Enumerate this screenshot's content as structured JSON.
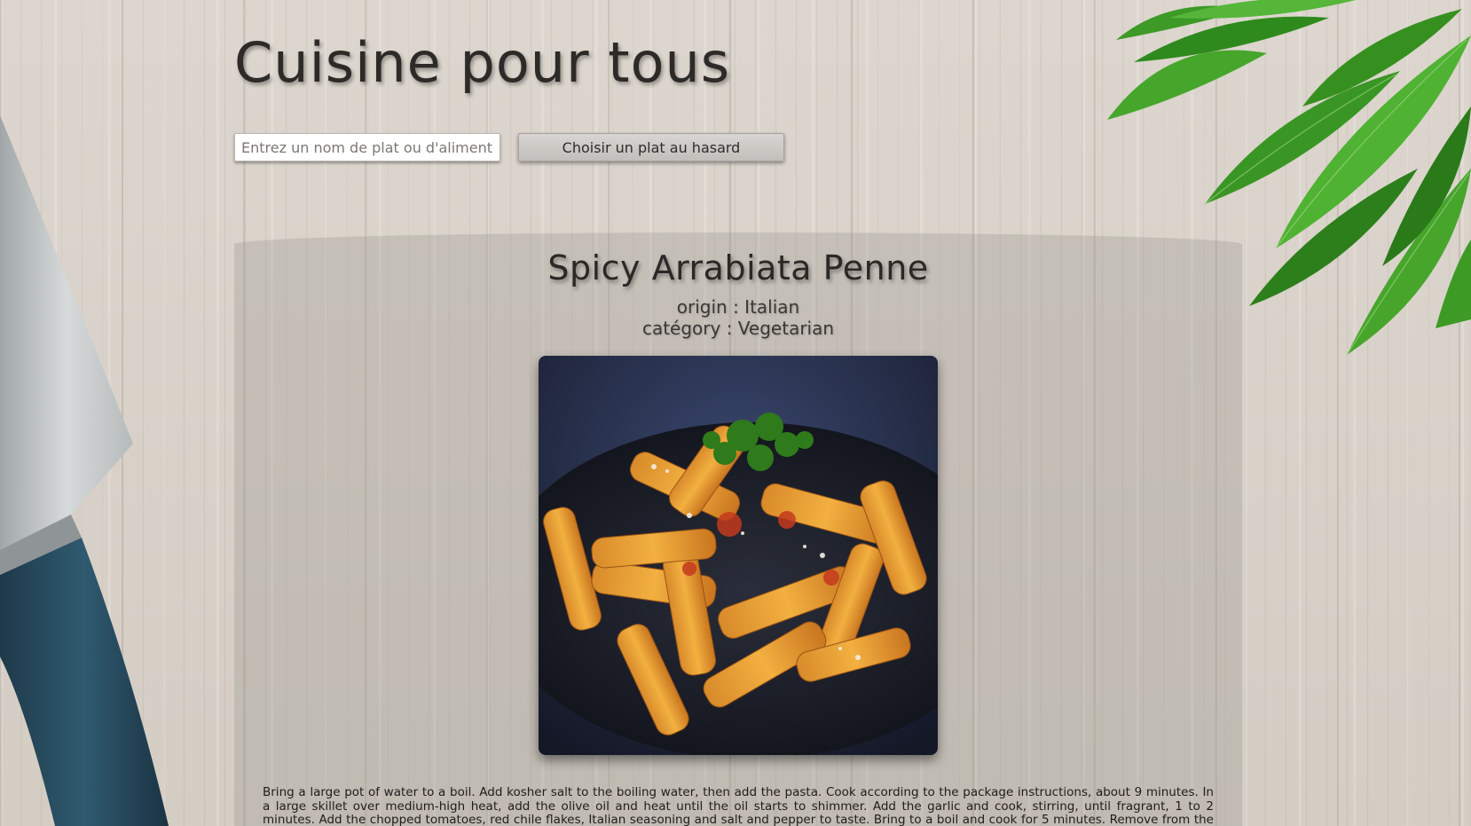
{
  "header": {
    "site_title": "Cuisine pour tous"
  },
  "search": {
    "placeholder": "Entrez un nom de plat ou d'aliment",
    "value": ""
  },
  "random_button": {
    "label": "Choisir un plat au hasard"
  },
  "recipe": {
    "title": "Spicy Arrabiata Penne",
    "origin_text": "origin : Italian",
    "category_text": "catégory : Vegetarian",
    "image_icon": "pasta-dish-photo",
    "instructions": "Bring a large pot of water to a boil. Add kosher salt to the boiling water, then add the pasta. Cook according to the package instructions, about 9 minutes. In a large skillet over medium-high heat, add the olive oil and heat until the oil starts to shimmer. Add the garlic and cook, stirring, until fragrant, 1 to 2 minutes. Add the chopped tomatoes, red chile flakes, Italian seasoning and salt and pepper to taste. Bring to a boil and cook for 5 minutes. Remove from the heat and"
  },
  "colors": {
    "background_wood": "#d9d3cb",
    "title_text": "#2d2a28",
    "panel_overlay": "rgba(150,145,140,0.30)"
  }
}
